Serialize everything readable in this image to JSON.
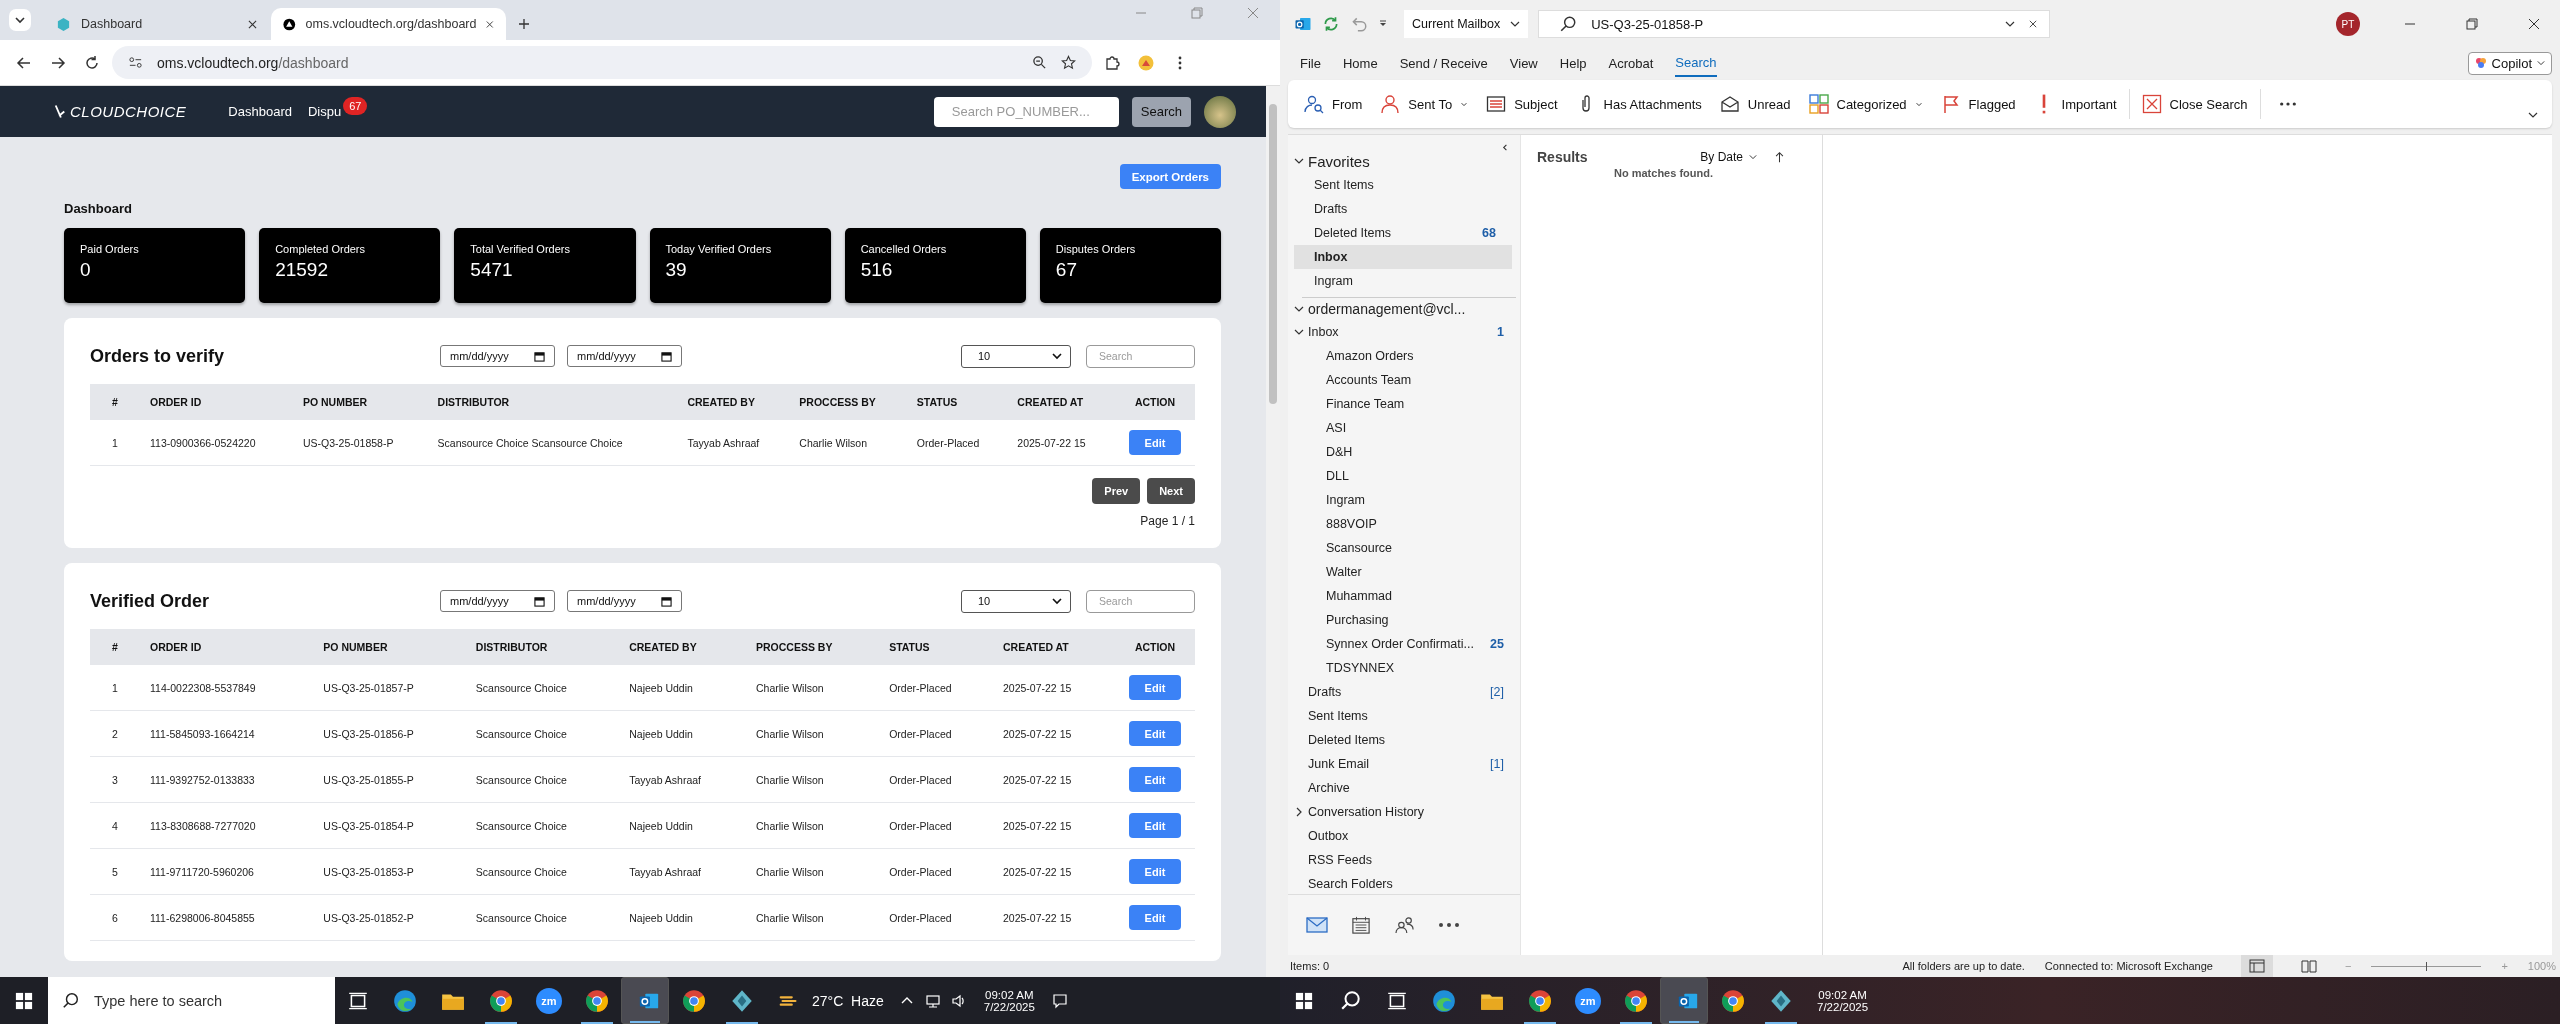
{
  "browser": {
    "tabs": [
      {
        "title": "Dashboard",
        "selected": false
      },
      {
        "title": "oms.vcloudtech.org/dashboard",
        "selected": true
      }
    ],
    "address_host": "oms.vcloudtech.org",
    "address_path": "/dashboard"
  },
  "app": {
    "logo": "CLOUDCHOICE",
    "nav": [
      {
        "label": "Dashboard"
      },
      {
        "label": "Dispu",
        "badge": "67"
      }
    ],
    "search_placeholder": "Search PO_NUMBER...",
    "search_button": "Search",
    "export_button": "Export Orders",
    "page_title": "Dashboard",
    "stats": [
      {
        "label": "Paid Orders",
        "value": "0"
      },
      {
        "label": "Completed Orders",
        "value": "21592"
      },
      {
        "label": "Total Verified Orders",
        "value": "5471"
      },
      {
        "label": "Today Verified Orders",
        "value": "39"
      },
      {
        "label": "Cancelled Orders",
        "value": "516"
      },
      {
        "label": "Disputes Orders",
        "value": "67"
      }
    ]
  },
  "tables": [
    {
      "title": "Orders to verify",
      "date_placeholders": [
        "mm/dd/yyyy",
        "mm/dd/yyyy"
      ],
      "page_size": "10",
      "search_placeholder": "Search",
      "columns": [
        "#",
        "ORDER ID",
        "PO NUMBER",
        "DISTRIBUTOR",
        "CREATED BY",
        "PROCCESS BY",
        "STATUS",
        "CREATED AT",
        "ACTION"
      ],
      "rows": [
        {
          "cells": [
            "1",
            "113-0900366-0524220",
            "US-Q3-25-01858-P",
            "Scansource Choice Scansource Choice",
            "Tayyab Ashraaf",
            "Charlie Wilson",
            "Order-Placed",
            "2025-07-22 15"
          ],
          "action": "Edit"
        }
      ],
      "pagination": {
        "prev": "Prev",
        "next": "Next",
        "page": "Page 1 / 1"
      }
    },
    {
      "title": "Verified Order",
      "date_placeholders": [
        "mm/dd/yyyy",
        "mm/dd/yyyy"
      ],
      "page_size": "10",
      "search_placeholder": "Search",
      "columns": [
        "#",
        "ORDER ID",
        "PO NUMBER",
        "DISTRIBUTOR",
        "CREATED BY",
        "PROCCESS BY",
        "STATUS",
        "CREATED AT",
        "ACTION"
      ],
      "rows": [
        {
          "cells": [
            "1",
            "114-0022308-5537849",
            "US-Q3-25-01857-P",
            "Scansource Choice",
            "Najeeb Uddin",
            "Charlie Wilson",
            "Order-Placed",
            "2025-07-22 15"
          ],
          "action": "Edit"
        },
        {
          "cells": [
            "2",
            "111-5845093-1664214",
            "US-Q3-25-01856-P",
            "Scansource Choice",
            "Najeeb Uddin",
            "Charlie Wilson",
            "Order-Placed",
            "2025-07-22 15"
          ],
          "action": "Edit"
        },
        {
          "cells": [
            "3",
            "111-9392752-0133833",
            "US-Q3-25-01855-P",
            "Scansource Choice",
            "Tayyab Ashraaf",
            "Charlie Wilson",
            "Order-Placed",
            "2025-07-22 15"
          ],
          "action": "Edit"
        },
        {
          "cells": [
            "4",
            "113-8308688-7277020",
            "US-Q3-25-01854-P",
            "Scansource Choice",
            "Najeeb Uddin",
            "Charlie Wilson",
            "Order-Placed",
            "2025-07-22 15"
          ],
          "action": "Edit"
        },
        {
          "cells": [
            "5",
            "111-9711720-5960206",
            "US-Q3-25-01853-P",
            "Scansource Choice",
            "Tayyab Ashraaf",
            "Charlie Wilson",
            "Order-Placed",
            "2025-07-22 15"
          ],
          "action": "Edit"
        },
        {
          "cells": [
            "6",
            "111-6298006-8045855",
            "US-Q3-25-01852-P",
            "Scansource Choice",
            "Najeeb Uddin",
            "Charlie Wilson",
            "Order-Placed",
            "2025-07-22 15"
          ],
          "action": "Edit"
        }
      ]
    }
  ],
  "outlook": {
    "search_scope": "Current Mailbox",
    "search_value": "US-Q3-25-01858-P",
    "avatar": "PT",
    "copilot": "Copilot",
    "menu": [
      {
        "label": "File",
        "selected": false
      },
      {
        "label": "Home",
        "selected": false
      },
      {
        "label": "Send / Receive",
        "selected": false
      },
      {
        "label": "View",
        "selected": false
      },
      {
        "label": "Help",
        "selected": false
      },
      {
        "label": "Acrobat",
        "selected": false
      },
      {
        "label": "Search",
        "selected": true
      }
    ],
    "ribbon": [
      {
        "kind": "from",
        "label": "From",
        "dropdown": false
      },
      {
        "kind": "sent-to",
        "label": "Sent To",
        "dropdown": true
      },
      {
        "kind": "subject",
        "label": "Subject",
        "dropdown": false
      },
      {
        "kind": "attachments",
        "label": "Has Attachments",
        "dropdown": false
      },
      {
        "kind": "unread",
        "label": "Unread",
        "dropdown": false
      },
      {
        "kind": "categorized",
        "label": "Categorized",
        "dropdown": true
      },
      {
        "kind": "flagged",
        "label": "Flagged",
        "dropdown": false
      },
      {
        "kind": "important",
        "label": "Important",
        "dropdown": false
      },
      {
        "kind": "close",
        "label": "Close Search",
        "dropdown": false
      }
    ],
    "favorites": {
      "label": "Favorites",
      "expanded": true,
      "items": [
        {
          "name": "Sent Items",
          "selected": false
        },
        {
          "name": "Drafts",
          "selected": false
        },
        {
          "name": "Deleted Items",
          "count": "68",
          "kind": "unread",
          "selected": false
        },
        {
          "name": "Inbox",
          "selected": true
        },
        {
          "name": "Ingram",
          "selected": false
        }
      ]
    },
    "account": {
      "label": "ordermanagement@vcl...",
      "expanded": true,
      "folders": [
        {
          "name": "Inbox",
          "count": "1",
          "kind": "unread",
          "expanded": true,
          "children": [
            {
              "name": "Amazon Orders"
            },
            {
              "name": "Accounts Team"
            },
            {
              "name": "Finance Team"
            },
            {
              "name": "ASI"
            },
            {
              "name": "D&H"
            },
            {
              "name": "DLL"
            },
            {
              "name": "Ingram"
            },
            {
              "name": "888VOIP"
            },
            {
              "name": "Scansource"
            },
            {
              "name": "Walter"
            },
            {
              "name": "Muhammad"
            },
            {
              "name": "Purchasing"
            },
            {
              "name": "Synnex Order Confirmati...",
              "count": "25",
              "kind": "unread"
            },
            {
              "name": "TDSYNNEX"
            }
          ]
        },
        {
          "name": "Drafts",
          "count": "[2]",
          "kind": "total"
        },
        {
          "name": "Sent Items"
        },
        {
          "name": "Deleted Items"
        },
        {
          "name": "Junk Email",
          "count": "[1]",
          "kind": "total"
        },
        {
          "name": "Archive"
        },
        {
          "name": "Conversation History",
          "expanded": false
        },
        {
          "name": "Outbox"
        },
        {
          "name": "RSS Feeds"
        },
        {
          "name": "Search Folders"
        }
      ]
    },
    "nav_modules": [
      {
        "kind": "mail",
        "selected": true
      },
      {
        "kind": "calendar",
        "selected": false
      },
      {
        "kind": "people",
        "selected": false
      },
      {
        "kind": "more",
        "selected": false
      }
    ],
    "results": {
      "title": "Results",
      "sort": "By Date",
      "empty": "No matches found."
    },
    "status": {
      "items": "Items: 0",
      "sync": "All folders are up to date.",
      "connection": "Connected to: Microsoft Exchange",
      "zoom_out": "−",
      "zoom_in": "+",
      "zoom": "100%",
      "zoom_level": {
        "level": 0.5
      }
    }
  },
  "taskbars": [
    {
      "search_placeholder": "Type here to search",
      "weather": "27°C  Haze",
      "time": "09:02 AM",
      "date": "7/22/2025",
      "apps": [
        {
          "kind": "edge",
          "running": false,
          "selected": false
        },
        {
          "kind": "explorer",
          "running": false,
          "selected": false
        },
        {
          "kind": "chrome",
          "running": true,
          "selected": false
        },
        {
          "kind": "zoom",
          "label": "zm",
          "running": false,
          "selected": false
        },
        {
          "kind": "chrome",
          "running": true,
          "selected": false
        },
        {
          "kind": "outlook",
          "running": true,
          "selected": true
        },
        {
          "kind": "chrome",
          "running": false,
          "selected": false
        },
        {
          "kind": "app",
          "running": true,
          "selected": false
        }
      ]
    },
    {
      "time": "09:02 AM",
      "date": "7/22/2025",
      "apps": [
        {
          "kind": "edge",
          "running": false,
          "selected": false
        },
        {
          "kind": "explorer",
          "running": false,
          "selected": false
        },
        {
          "kind": "chrome",
          "running": true,
          "selected": false
        },
        {
          "kind": "zoom",
          "label": "zm",
          "running": false,
          "selected": false
        },
        {
          "kind": "chrome",
          "running": true,
          "selected": false
        },
        {
          "kind": "outlook",
          "running": true,
          "selected": true
        },
        {
          "kind": "chrome",
          "running": false,
          "selected": false
        },
        {
          "kind": "app",
          "running": true,
          "selected": false
        }
      ]
    }
  ]
}
